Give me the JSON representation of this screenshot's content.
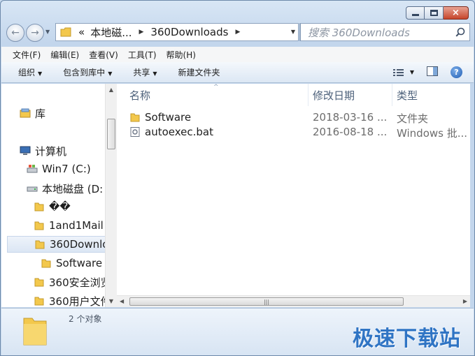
{
  "window": {
    "caption_buttons": {
      "minimize": "minimize",
      "maximize": "maximize",
      "close": "×"
    }
  },
  "address_bar": {
    "prefix": "«",
    "parts": [
      "本地磁...",
      "360Downloads"
    ],
    "search_placeholder": "搜索 360Downloads"
  },
  "menu": [
    "文件(F)",
    "编辑(E)",
    "查看(V)",
    "工具(T)",
    "帮助(H)"
  ],
  "commands": [
    "组织",
    "包含到库中",
    "共享",
    "新建文件夹"
  ],
  "nav_tree": [
    {
      "label": "库",
      "icon": "library-icon"
    },
    {
      "label": "计算机",
      "icon": "computer-icon"
    },
    {
      "label": "Win7 (C:)",
      "icon": "drive-c-icon"
    },
    {
      "label": "本地磁盘 (D:",
      "icon": "drive-d-icon"
    },
    {
      "label": "��",
      "icon": "folder-icon"
    },
    {
      "label": "1and1Mail",
      "icon": "folder-icon"
    },
    {
      "label": "360Downlo",
      "icon": "folder-icon",
      "selected": true
    },
    {
      "label": "Software",
      "icon": "folder-icon"
    },
    {
      "label": "360安全浏览",
      "icon": "folder-icon"
    },
    {
      "label": "360用户文件",
      "icon": "folder-icon"
    }
  ],
  "columns": {
    "name": "名称",
    "date": "修改日期",
    "type": "类型"
  },
  "files": [
    {
      "name": "Software",
      "date": "2018-03-16 ...",
      "type": "文件夹",
      "icon": "folder-icon"
    },
    {
      "name": "autoexec.bat",
      "date": "2016-08-18 ...",
      "type": "Windows 批...",
      "icon": "batch-file-icon"
    }
  ],
  "status": {
    "item_count": "2 个对象"
  },
  "watermark": "极速下载站",
  "colors": {
    "folder": "#f3c84c",
    "accent": "#2f74c4"
  }
}
